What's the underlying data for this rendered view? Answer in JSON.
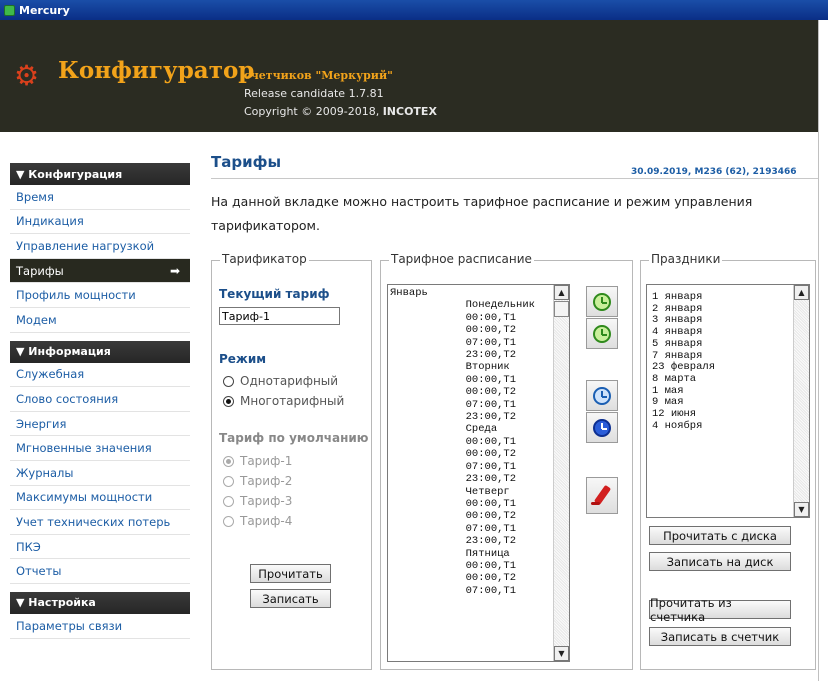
{
  "window": {
    "title": "Mercury"
  },
  "header": {
    "app_title": "Конфигуратор",
    "app_subtitle": "счетчиков \"Меркурий\"",
    "release": "Release candidate 1.7.81",
    "copyright_prefix": "Copyright © 2009-2018, ",
    "copyright_company": "INCOTEX"
  },
  "sidebar": {
    "sections": [
      {
        "title": "▼ Конфигурация",
        "items": [
          "Время",
          "Индикация",
          "Управление нагрузкой",
          "Тарифы",
          "Профиль мощности",
          "Модем"
        ]
      },
      {
        "title": "▼ Информация",
        "items": [
          "Служебная",
          "Слово состояния",
          "Энергия",
          "Мгновенные значения",
          "Журналы",
          "Максимумы мощности",
          "Учет технических потерь",
          "ПКЭ",
          "Отчеты"
        ]
      },
      {
        "title": "▼ Настройка",
        "items": [
          "Параметры связи"
        ]
      }
    ],
    "active_item": "Тарифы"
  },
  "main": {
    "title": "Тарифы",
    "meta": "30.09.2019, M236 (62), 2193466",
    "description": "На данной вкладке можно настроить тарифное расписание и режим управления тарификатором."
  },
  "tarifikator": {
    "legend": "Тарификатор",
    "current_tariff_label": "Текущий тариф",
    "current_tariff_value": "Тариф-1",
    "mode_label": "Режим",
    "mode_options": [
      {
        "label": "Однотарифный",
        "checked": false
      },
      {
        "label": "Многотарифный",
        "checked": true
      }
    ],
    "default_tariff_label": "Тариф по умолчанию",
    "default_options": [
      {
        "label": "Тариф-1",
        "checked": true
      },
      {
        "label": "Тариф-2",
        "checked": false
      },
      {
        "label": "Тариф-3",
        "checked": false
      },
      {
        "label": "Тариф-4",
        "checked": false
      }
    ],
    "read_button": "Прочитать",
    "write_button": "Записать"
  },
  "schedule": {
    "legend": "Тарифное расписание",
    "lines": [
      "Январь",
      "            Понедельник",
      "            00:00,T1",
      "            00:00,T2",
      "            07:00,T1",
      "            23:00,T2",
      "            Вторник",
      "            00:00,T1",
      "            00:00,T2",
      "            07:00,T1",
      "            23:00,T2",
      "            Среда",
      "            00:00,T1",
      "            00:00,T2",
      "            07:00,T1",
      "            23:00,T2",
      "            Четверг",
      "            00:00,T1",
      "            00:00,T2",
      "            07:00,T1",
      "            23:00,T2",
      "            Пятница",
      "            00:00,T1",
      "            00:00,T2",
      "            07:00,T1"
    ]
  },
  "holidays": {
    "legend": "Праздники",
    "items": [
      "1 января",
      "2 января",
      "3 января",
      "4 января",
      "5 января",
      "7 января",
      "23 февраля",
      "8 марта",
      "1 мая",
      "9 мая",
      "12 июня",
      "4 ноября"
    ],
    "read_disk_button": "Прочитать с диска",
    "write_disk_button": "Записать на диск",
    "read_meter_button": "Прочитать из счетчика",
    "write_meter_button": "Записать в счетчик"
  },
  "colors": {
    "banner_bg": "#2b2c22",
    "title_accent": "#f2a31a",
    "link_blue": "#1c5da5",
    "active_nav_bg": "#28291f"
  }
}
